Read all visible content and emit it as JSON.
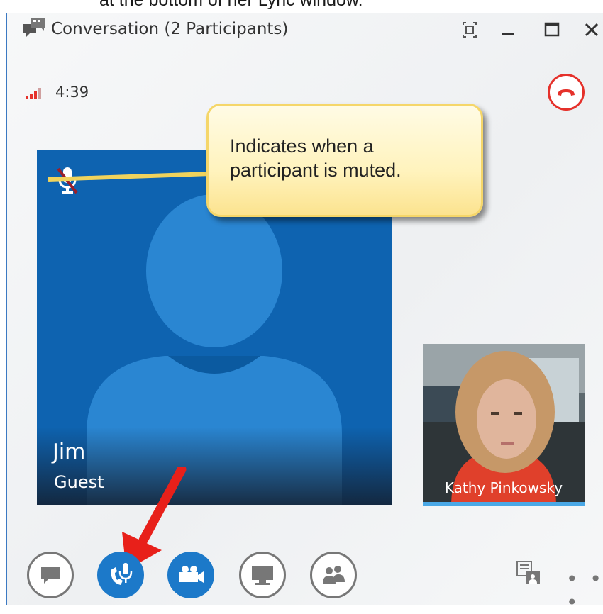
{
  "caption": "at the bottom of her Lync window.",
  "window": {
    "title": "Conversation (2 Participants)",
    "icons": {
      "app": "conversation-icon",
      "full_screen": "full-screen-icon",
      "minimize": "minimize-icon",
      "maximize": "maximize-icon",
      "close": "close-icon"
    }
  },
  "call": {
    "signal_icon": "signal-strength-icon",
    "duration": "4:39",
    "hangup_icon": "hang-up-phone-icon",
    "hangup_color": "#e5312b"
  },
  "participants": [
    {
      "name": "Jim",
      "role": "Guest",
      "avatar_icon": "person-silhouette-icon",
      "muted": true,
      "tile_color": "#0e63b0"
    },
    {
      "name": "Kathy Pinkowsky",
      "video": true
    }
  ],
  "callout": {
    "text_line1": "Indicates when a",
    "text_line2": "participant is muted."
  },
  "toolbar": {
    "buttons": [
      {
        "icon": "im-chat-icon",
        "style": "outline"
      },
      {
        "icon": "phone-mic-icon",
        "style": "filled"
      },
      {
        "icon": "video-camera-icon",
        "style": "filled"
      },
      {
        "icon": "present-screen-icon",
        "style": "outline"
      },
      {
        "icon": "participants-icon",
        "style": "outline"
      }
    ],
    "layout_icon": "conversation-layout-icon",
    "more_label": "• • •"
  },
  "annotation": {
    "arrow_icon": "red-arrow-icon",
    "arrow_color": "#e8201a"
  },
  "colors": {
    "accent": "#1c79c9",
    "window_border": "#3b79c2"
  }
}
